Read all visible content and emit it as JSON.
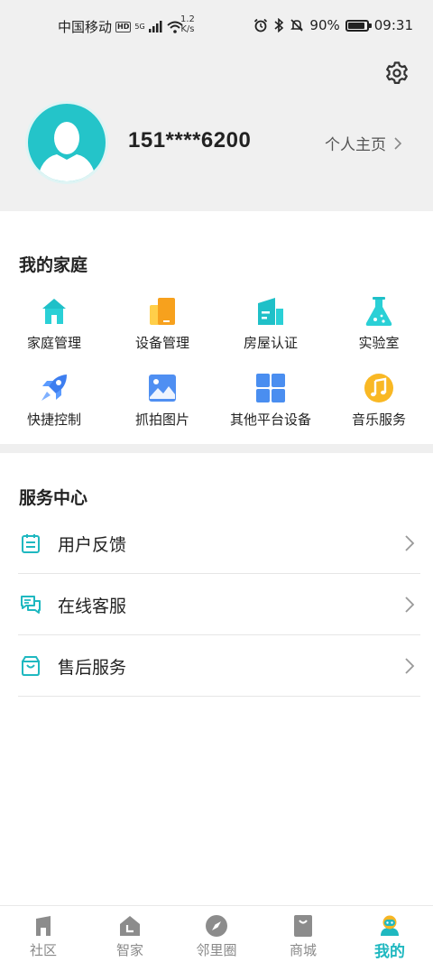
{
  "status_bar": {
    "carrier": "中国移动",
    "hd_badge": "HD",
    "network": "5G",
    "speed_value": "1.2",
    "speed_unit": "K/s",
    "battery_percent": "90%",
    "battery_level": 0.9,
    "time": "09:31"
  },
  "profile": {
    "phone": "151****6200",
    "homepage_link": "个人主页"
  },
  "family": {
    "title": "我的家庭",
    "items": [
      {
        "label": "家庭管理",
        "icon": "house-icon"
      },
      {
        "label": "设备管理",
        "icon": "device-icon"
      },
      {
        "label": "房屋认证",
        "icon": "building-icon"
      },
      {
        "label": "实验室",
        "icon": "flask-icon"
      },
      {
        "label": "快捷控制",
        "icon": "rocket-icon"
      },
      {
        "label": "抓拍图片",
        "icon": "image-icon"
      },
      {
        "label": "其他平台设备",
        "icon": "grid-icon"
      },
      {
        "label": "音乐服务",
        "icon": "music-icon"
      }
    ]
  },
  "services": {
    "title": "服务中心",
    "items": [
      {
        "label": "用户反馈",
        "icon": "calendar-icon"
      },
      {
        "label": "在线客服",
        "icon": "chat-icon"
      },
      {
        "label": "售后服务",
        "icon": "bag-icon"
      }
    ]
  },
  "bottom_nav": {
    "tabs": [
      {
        "label": "社区",
        "icon": "community-icon",
        "active": false
      },
      {
        "label": "智家",
        "icon": "smart-home-icon",
        "active": false
      },
      {
        "label": "邻里圈",
        "icon": "compass-icon",
        "active": false
      },
      {
        "label": "商城",
        "icon": "shop-icon",
        "active": false
      },
      {
        "label": "我的",
        "icon": "me-icon",
        "active": true
      }
    ]
  },
  "colors": {
    "accent": "#1fb8c0",
    "avatar_bg": "#24c4c9",
    "header_bg": "#f0f0f0"
  }
}
